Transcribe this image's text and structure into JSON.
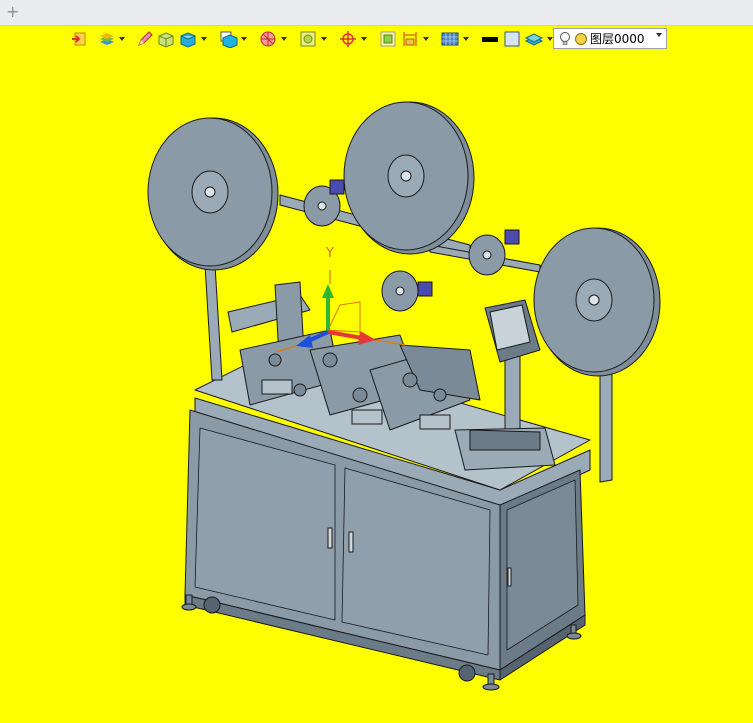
{
  "tabbar": {
    "new_tab_symbol": "+"
  },
  "toolbar": {
    "icons": [
      "exit-icon",
      "layers-icon",
      "pencil-icon",
      "box-open-icon",
      "cube-icon",
      "cube-solid-icon",
      "section-icon",
      "boundary-icon",
      "snap-icon",
      "fit-icon",
      "dimension-icon",
      "display-style-icon",
      "line-color-icon",
      "fill-color-icon",
      "render-icon"
    ]
  },
  "layer": {
    "label": "图层0000",
    "lamp_icon": "lightbulb-icon",
    "color_icon": "layer-color-icon"
  },
  "viewport": {
    "background": "#ffff00",
    "axis_label_y": "Y",
    "axis_colors": {
      "x": "#e53935",
      "y": "#2eb82e",
      "z": "#1e4fd8"
    }
  },
  "colors": {
    "machine": "#8a9aa6",
    "machine_dark": "#6b7b87",
    "outline": "#1a1a1a"
  }
}
